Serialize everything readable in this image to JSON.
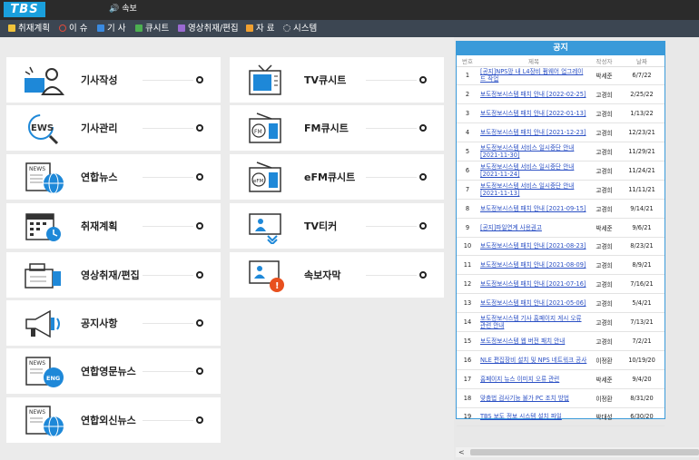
{
  "app": {
    "logo": "TBS",
    "ticker_label": "속보"
  },
  "menu": [
    {
      "label": "취재계획",
      "icon": "calendar-icon",
      "color": "#f0c23a"
    },
    {
      "label": "이 슈",
      "icon": "issue-icon",
      "color": "#e04a3a"
    },
    {
      "label": "기 사",
      "icon": "article-icon",
      "color": "#3a8ae0"
    },
    {
      "label": "큐시트",
      "icon": "cuesheet-icon",
      "color": "#4caf50"
    },
    {
      "label": "영상취재/편집",
      "icon": "video-icon",
      "color": "#9a6ad0"
    },
    {
      "label": "자 료",
      "icon": "data-icon",
      "color": "#f0a030"
    },
    {
      "label": "시스템",
      "icon": "gear-icon",
      "color": "#cccccc"
    }
  ],
  "left_cards": [
    {
      "label": "기사작성",
      "icon": "writer-icon"
    },
    {
      "label": "기사관리",
      "icon": "news-search-icon"
    },
    {
      "label": "연합뉴스",
      "icon": "news-globe-icon"
    },
    {
      "label": "취재계획",
      "icon": "calendar-clock-icon"
    },
    {
      "label": "영상취재/편집",
      "icon": "camera-icon"
    },
    {
      "label": "공지사항",
      "icon": "megaphone-icon"
    },
    {
      "label": "연합영문뉴스",
      "icon": "news-eng-icon"
    },
    {
      "label": "연합외신뉴스",
      "icon": "news-foreign-icon"
    }
  ],
  "right_cards": [
    {
      "label": "TV큐시트",
      "icon": "tv-list-icon"
    },
    {
      "label": "FM큐시트",
      "icon": "fm-radio-icon"
    },
    {
      "label": "eFM큐시트",
      "icon": "efm-radio-icon"
    },
    {
      "label": "TV티커",
      "icon": "tv-ticker-icon"
    },
    {
      "label": "속보자막",
      "icon": "breaking-caption-icon"
    }
  ],
  "notice": {
    "title": "공지",
    "columns": [
      "번호",
      "제목",
      "작성자",
      "날짜"
    ],
    "rows": [
      {
        "no": "1",
        "title": "[공지]NPS망 내 L4장비 펌웨어 업그레이드 작업",
        "author": "박세준",
        "date": "6/7/22"
      },
      {
        "no": "2",
        "title": "보도정보시스템 패치 안내 [2022-02-25]",
        "author": "고경희",
        "date": "2/25/22"
      },
      {
        "no": "3",
        "title": "보도정보시스템 패치 안내 [2022-01-13]",
        "author": "고경희",
        "date": "1/13/22"
      },
      {
        "no": "4",
        "title": "보도정보시스템 패치 안내 [2021-12-23]",
        "author": "고경희",
        "date": "12/23/21"
      },
      {
        "no": "5",
        "title": "보도정보시스템 서비스 일시중단 안내 [2021-11-30]",
        "author": "고경희",
        "date": "11/29/21"
      },
      {
        "no": "6",
        "title": "보도정보시스템 서비스 일시중단 안내 [2021-11-24]",
        "author": "고경희",
        "date": "11/24/21"
      },
      {
        "no": "7",
        "title": "보도정보시스템 서비스 일시중단 안내 [2021-11-13]",
        "author": "고경희",
        "date": "11/11/21"
      },
      {
        "no": "8",
        "title": "보도정보시스템 패치 안내 [2021-09-15]",
        "author": "고경희",
        "date": "9/14/21"
      },
      {
        "no": "9",
        "title": "[공지]파일연계 사용권고",
        "author": "박세준",
        "date": "9/6/21"
      },
      {
        "no": "10",
        "title": "보도정보시스템 패치 안내 [2021-08-23]",
        "author": "고경희",
        "date": "8/23/21"
      },
      {
        "no": "11",
        "title": "보도정보시스템 패치 안내 [2021-08-09]",
        "author": "고경희",
        "date": "8/9/21"
      },
      {
        "no": "12",
        "title": "보도정보시스템 패치 안내 [2021-07-16]",
        "author": "고경희",
        "date": "7/16/21"
      },
      {
        "no": "13",
        "title": "보도정보시스템 패치 안내 [2021-05-06]",
        "author": "고경희",
        "date": "5/4/21"
      },
      {
        "no": "14",
        "title": "보도정보시스템 기사 홈페이지 게시 오류 관련 안내",
        "author": "고경희",
        "date": "7/13/21"
      },
      {
        "no": "15",
        "title": "보도정보시스템 웹 버전 패치 안내",
        "author": "고경희",
        "date": "7/2/21"
      },
      {
        "no": "16",
        "title": "NLE 편집장비 설치 및 NPS 네트워크 공사",
        "author": "이정환",
        "date": "10/19/20"
      },
      {
        "no": "17",
        "title": "홈페이지 뉴스 이미지 오류 관련",
        "author": "박세준",
        "date": "9/4/20"
      },
      {
        "no": "18",
        "title": "맞춤법 검사기능 불가 PC 조치 방법",
        "author": "이정환",
        "date": "8/31/20"
      },
      {
        "no": "19",
        "title": "TBS 보도 정보 시스템 설치 파일",
        "author": "박대성",
        "date": "6/30/20"
      }
    ]
  }
}
